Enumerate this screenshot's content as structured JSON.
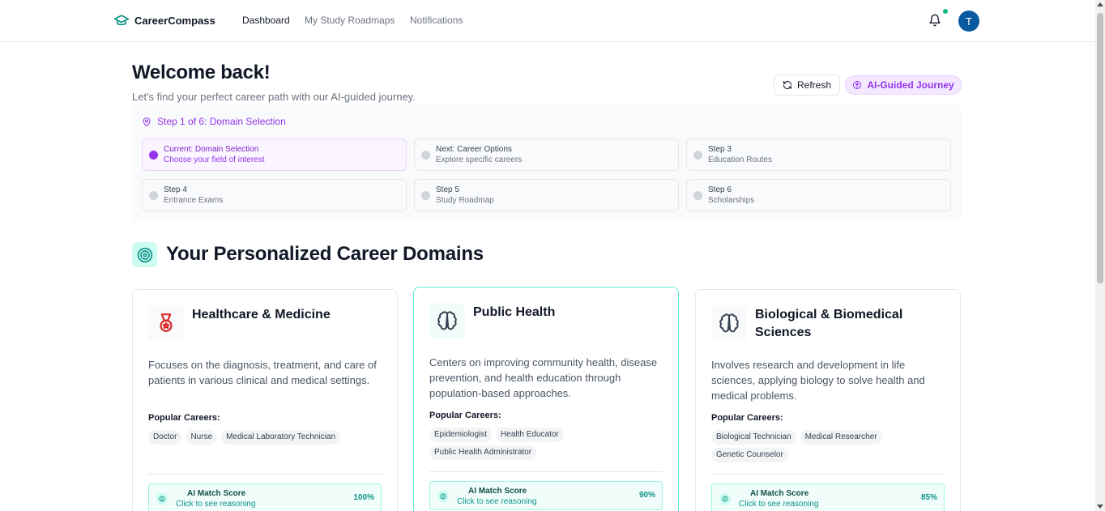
{
  "app": {
    "name": "CareerCompass"
  },
  "nav": {
    "links": [
      {
        "label": "Dashboard",
        "active": true
      },
      {
        "label": "My Study Roadmaps",
        "active": false
      },
      {
        "label": "Notifications",
        "active": false
      }
    ],
    "avatar_initial": "T",
    "notification_dot_color": "#10b981"
  },
  "header": {
    "title": "Welcome back!",
    "subtitle": "Let's find your perfect career path with our AI-guided journey.",
    "refresh_label": "Refresh",
    "ai_badge_label": "AI-Guided Journey"
  },
  "steps": {
    "heading": "Step 1 of 6: Domain Selection",
    "items": [
      {
        "title": "Current: Domain Selection",
        "subtitle": "Choose your field of interest",
        "current": true
      },
      {
        "title": "Next: Career Options",
        "subtitle": "Explore specific careers",
        "current": false
      },
      {
        "title": "Step 3",
        "subtitle": "Education Routes",
        "current": false
      },
      {
        "title": "Step 4",
        "subtitle": "Entrance Exams",
        "current": false
      },
      {
        "title": "Step 5",
        "subtitle": "Study Roadmap",
        "current": false
      },
      {
        "title": "Step 6",
        "subtitle": "Scholarships",
        "current": false
      }
    ]
  },
  "section": {
    "title": "Your Personalized Career Domains"
  },
  "cards": [
    {
      "icon": "medal-icon",
      "title": "Healthcare & Medicine",
      "description": "Focuses on the diagnosis, treatment, and care of patients in various clinical and medical settings.",
      "popular_label": "Popular Careers:",
      "careers": [
        "Doctor",
        "Nurse",
        "Medical Laboratory Technician"
      ],
      "score_label": "AI Match Score",
      "score_sub": "Click to see reasoning",
      "score": "100%"
    },
    {
      "icon": "brain-icon",
      "title": "Public Health",
      "description": "Centers on improving community health, disease prevention, and health education through population-based approaches.",
      "popular_label": "Popular Careers:",
      "careers": [
        "Epidemiologist",
        "Health Educator",
        "Public Health Administrator"
      ],
      "score_label": "AI Match Score",
      "score_sub": "Click to see reasoning",
      "score": "90%"
    },
    {
      "icon": "brain-icon",
      "title": "Biological & Biomedical Sciences",
      "description": "Involves research and development in life sciences, applying biology to solve health and medical problems.",
      "popular_label": "Popular Careers:",
      "careers": [
        "Biological Technician",
        "Medical Researcher",
        "Genetic Counselor"
      ],
      "score_label": "AI Match Score",
      "score_sub": "Click to see reasoning",
      "score": "85%"
    }
  ],
  "colors": {
    "accent_purple": "#9333ea",
    "accent_teal": "#0d9488",
    "avatar_blue": "#0a5aa0"
  }
}
